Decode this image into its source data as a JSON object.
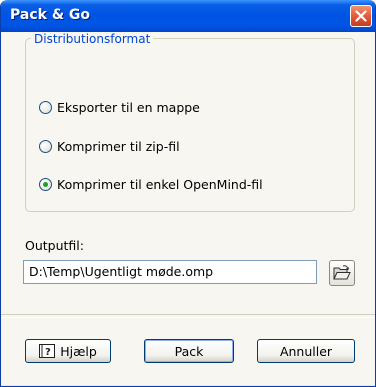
{
  "window": {
    "title": "Pack & Go"
  },
  "group": {
    "label": "Distributionsformat",
    "options": [
      {
        "label": "Eksporter til en mappe",
        "selected": false
      },
      {
        "label": "Komprimer til zip-fil",
        "selected": false
      },
      {
        "label": "Komprimer til enkel OpenMind-fil",
        "selected": true
      }
    ]
  },
  "output": {
    "label": "Outputfil:",
    "value": "D:\\Temp\\Ugentligt møde.omp",
    "browse_icon": "open-folder-icon"
  },
  "buttons": {
    "help": "Hjælp",
    "pack": "Pack",
    "cancel": "Annuller"
  }
}
